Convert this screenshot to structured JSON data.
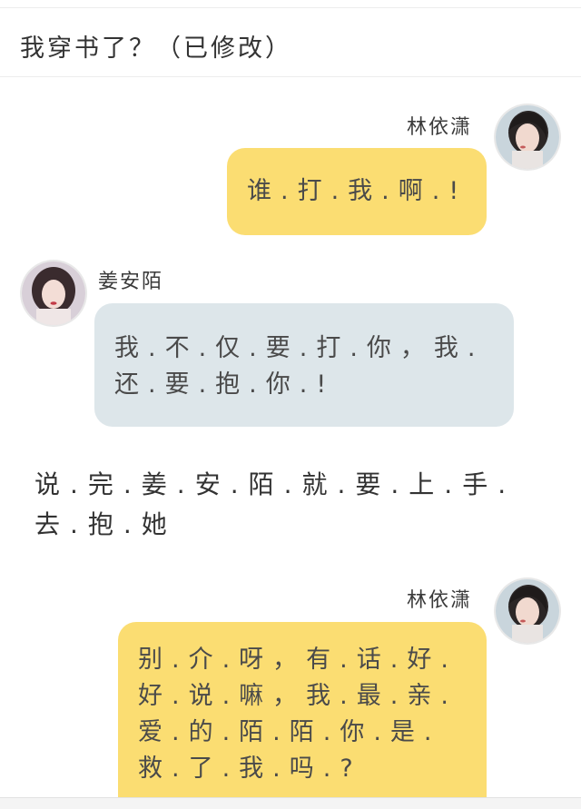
{
  "header": {
    "title": "我穿书了？（已修改）"
  },
  "messages": [
    {
      "speaker": "林依潇",
      "side": "right",
      "color": "#fbdd72",
      "text": "谁.打.我.啊.!"
    },
    {
      "speaker": "姜安陌",
      "side": "left",
      "color": "#dde6ea",
      "text": "我.不.仅.要.打.你，我.还.要.抱.你.!"
    },
    {
      "speaker": "林依潇",
      "side": "right",
      "color": "#fbdd72",
      "text": "别.介.呀，有.话.好.好.说.嘛，我.最.亲.爱.的.陌.陌.你.是.救.了.我.吗.?"
    }
  ],
  "narration": "说.完.姜.安.陌.就.要.上.手.去.抱.她",
  "avatars": {
    "lin": "avatar-lin-yixiao",
    "jiang": "avatar-jiang-anmo"
  }
}
